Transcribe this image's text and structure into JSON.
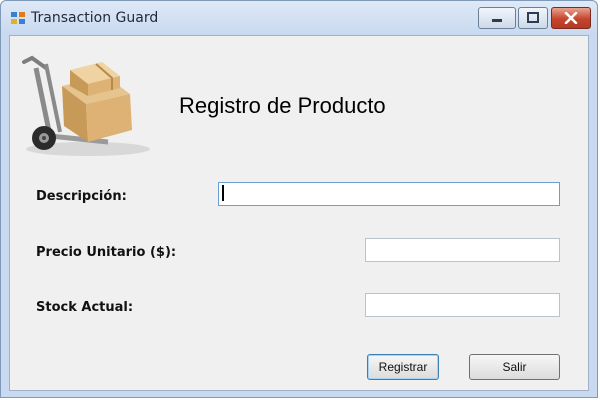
{
  "window": {
    "title": "Transaction Guard",
    "controls": {
      "minimize_icon": "minimize-icon",
      "maximize_icon": "maximize-icon",
      "close_icon": "close-icon"
    }
  },
  "form": {
    "heading": "Registro de Producto",
    "image_icon": "hand-truck-with-boxes-icon",
    "fields": [
      {
        "label": "Descripción:",
        "value": "",
        "placeholder": ""
      },
      {
        "label": "Precio Unitario ($):",
        "value": "",
        "placeholder": ""
      },
      {
        "label": "Stock Actual:",
        "value": "",
        "placeholder": ""
      }
    ],
    "buttons": {
      "register": "Registrar",
      "exit": "Salir"
    }
  },
  "colors": {
    "titlebar": "#c8d9ef",
    "close_button": "#c5452c",
    "client_bg": "#f0f0f0"
  }
}
